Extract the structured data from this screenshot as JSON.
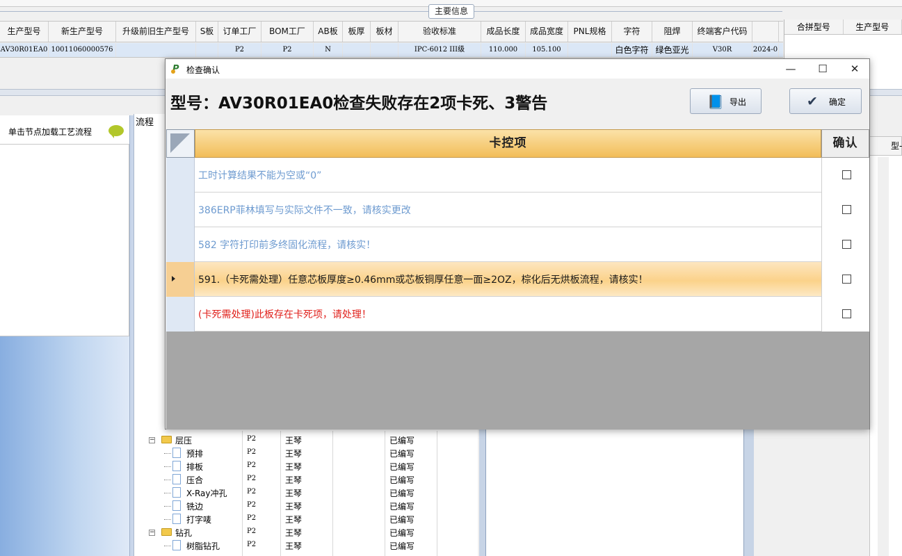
{
  "main_grid": {
    "group_title": "主要信息",
    "headers": [
      "生产型号",
      "新生产型号",
      "升级前旧生产型号",
      "S板",
      "订单工厂",
      "BOM工厂",
      "AB板",
      "板厚",
      "板材",
      "验收标准",
      "成品长度",
      "成品宽度",
      "PNL规格",
      "字符",
      "阻焊",
      "终端客户代码",
      ""
    ],
    "row": [
      "AV30R01EA0",
      "10011060000576",
      "",
      "",
      "P2",
      "P2",
      "N",
      "",
      "",
      "IPC-6012 III级",
      "110.000",
      "105.100",
      "",
      "白色字符",
      "绿色亚光",
      "V30R",
      "2024-0"
    ],
    "right_headers": [
      "合拼型号",
      "生产型号"
    ]
  },
  "left_panel": {
    "title": "单击节点加载工艺流程"
  },
  "tree": {
    "title": "流程",
    "rows": [
      {
        "name": "层压",
        "factory": "P2",
        "person": "王琴",
        "status": "已编写",
        "type": "folder"
      },
      {
        "name": "预排",
        "factory": "P2",
        "person": "王琴",
        "status": "已编写",
        "type": "doc"
      },
      {
        "name": "排板",
        "factory": "P2",
        "person": "王琴",
        "status": "已编写",
        "type": "doc"
      },
      {
        "name": "压合",
        "factory": "P2",
        "person": "王琴",
        "status": "已编写",
        "type": "doc"
      },
      {
        "name": "X-Ray冲孔",
        "factory": "P2",
        "person": "王琴",
        "status": "已编写",
        "type": "doc"
      },
      {
        "name": "铣边",
        "factory": "P2",
        "person": "王琴",
        "status": "已编写",
        "type": "doc"
      },
      {
        "name": "打字唛",
        "factory": "P2",
        "person": "王琴",
        "status": "已编写",
        "type": "doc"
      },
      {
        "name": "钻孔",
        "factory": "P2",
        "person": "王琴",
        "status": "已编写",
        "type": "folder"
      },
      {
        "name": "树脂钻孔",
        "factory": "P2",
        "person": "王琴",
        "status": "已编写",
        "type": "doc"
      }
    ]
  },
  "far_right": {
    "header": "型-"
  },
  "dialog": {
    "title": "检查确认",
    "window_controls": {
      "minimize": "—",
      "maximize": "☐",
      "close": "✕"
    },
    "headline": "型号：AV30R01EA0检查失败存在2项卡死、3警告",
    "export_label": "导出",
    "confirm_label": "确定",
    "grid": {
      "col_item": "卡控项",
      "col_confirm": "确认",
      "rows": [
        {
          "text": "工时计算结果不能为空或“0”",
          "color": "#6e9bd0"
        },
        {
          "text": "386ERP菲林填写与实际文件不一致，请核实更改",
          "color": "#6e9bd0"
        },
        {
          "text": "582 字符打印前多终固化流程，请核实！",
          "color": "#6e9bd0"
        },
        {
          "text": "591.（卡死需处理）任意芯板厚度≥0.46mm或芯板铜厚任意一面≥2OZ，棕化后无烘板流程，请核实！",
          "color": "#1a1a1a"
        },
        {
          "text": "(卡死需处理)此板存在卡死项，请处理！",
          "color": "#e0201b"
        }
      ]
    }
  }
}
